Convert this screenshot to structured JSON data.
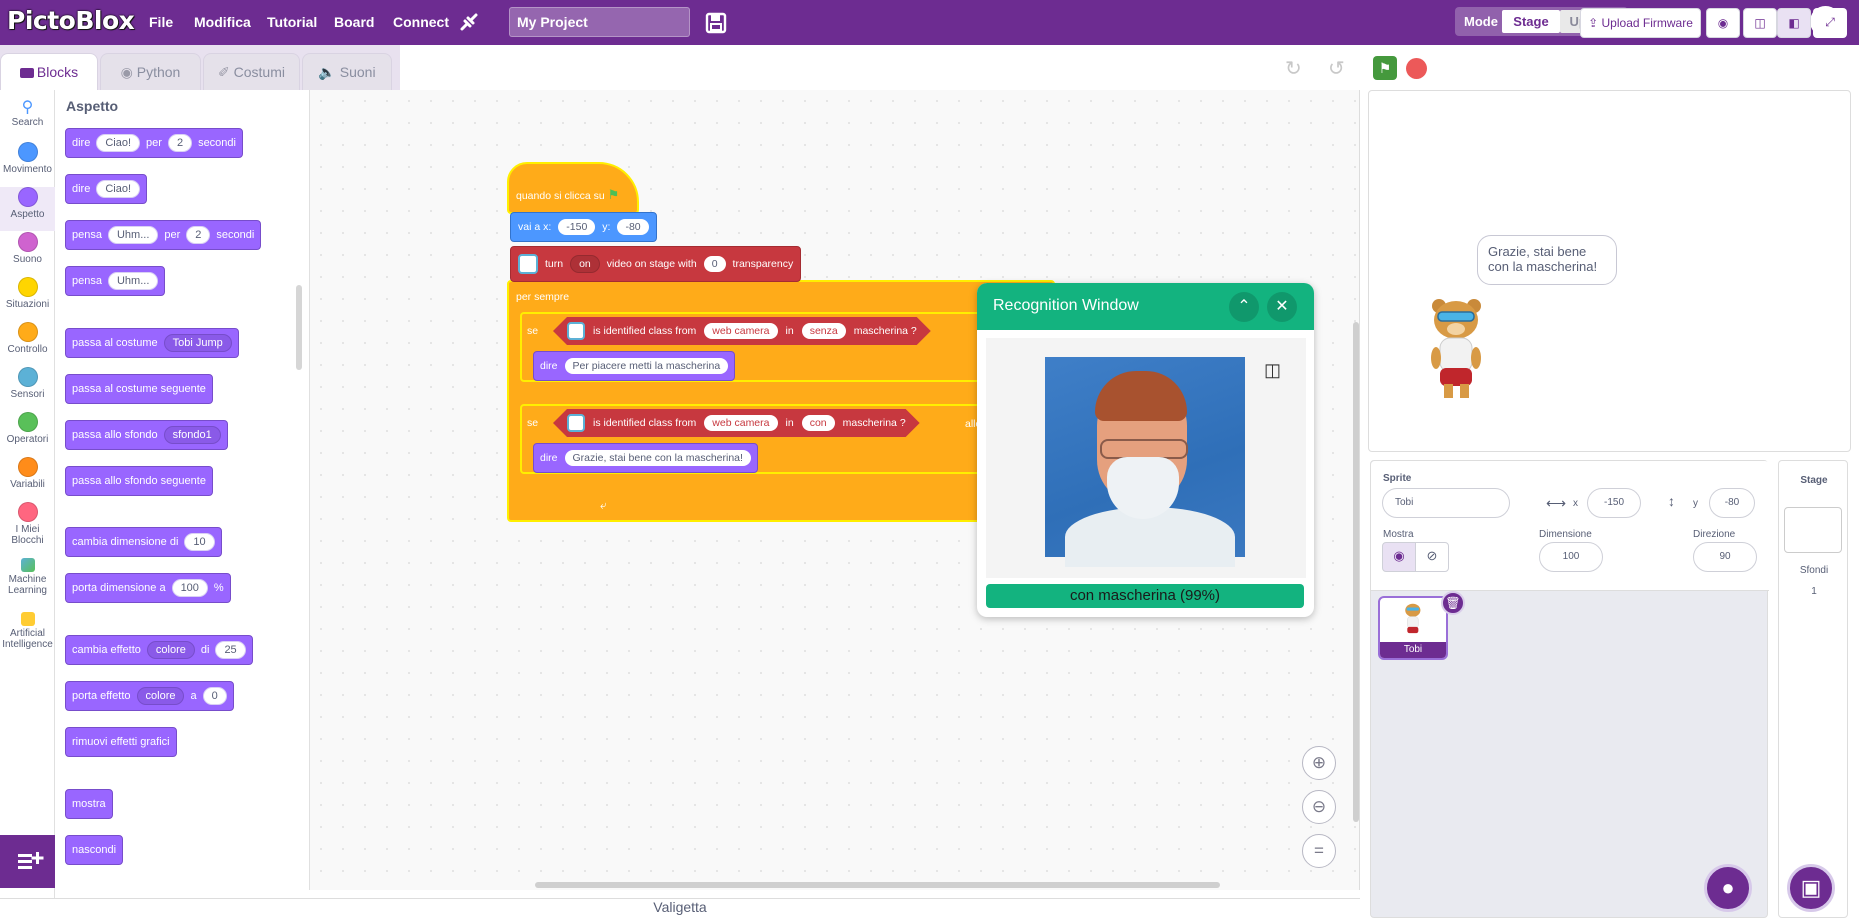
{
  "menubar": {
    "logo": "PictoBlox",
    "items": [
      "File",
      "Modifica",
      "Tutorial",
      "Board",
      "Connect"
    ],
    "project_title": "My Project",
    "mode_label": "Mode",
    "mode_stage": "Stage",
    "mode_upload": "Upload"
  },
  "tabs": [
    "Blocks",
    "Python",
    "Costumi",
    "Suoni"
  ],
  "categories": [
    {
      "label": "Search",
      "icon": "search-icon"
    },
    {
      "label": "Movimento",
      "color": "#4c97ff"
    },
    {
      "label": "Aspetto",
      "color": "#9966ff"
    },
    {
      "label": "Suono",
      "color": "#cf63cf"
    },
    {
      "label": "Situazioni",
      "color": "#ffd500"
    },
    {
      "label": "Controllo",
      "color": "#ffab19"
    },
    {
      "label": "Sensori",
      "color": "#5cb1d6"
    },
    {
      "label": "Operatori",
      "color": "#59c059"
    },
    {
      "label": "Variabili",
      "color": "#ff8c1a"
    },
    {
      "label": "I Miei Blocchi",
      "color": "#ff6680"
    },
    {
      "label": "Machine Learning",
      "icon": "ml-icon"
    },
    {
      "label": "Artificial Intelligence",
      "icon": "ai-icon"
    }
  ],
  "palette": {
    "title": "Aspetto",
    "b1": {
      "t1": "dire",
      "v1": "Ciao!",
      "t2": "per",
      "v2": "2",
      "t3": "secondi"
    },
    "b2": {
      "t1": "dire",
      "v1": "Ciao!"
    },
    "b3": {
      "t1": "pensa",
      "v1": "Uhm...",
      "t2": "per",
      "v2": "2",
      "t3": "secondi"
    },
    "b4": {
      "t1": "pensa",
      "v1": "Uhm..."
    },
    "b5": {
      "t1": "passa al costume",
      "v1": "Tobi Jump"
    },
    "b6": {
      "t1": "passa al costume seguente"
    },
    "b7": {
      "t1": "passa allo sfondo",
      "v1": "sfondo1"
    },
    "b8": {
      "t1": "passa allo sfondo seguente"
    },
    "b9": {
      "t1": "cambia dimensione di",
      "v1": "10"
    },
    "b10": {
      "t1": "porta dimensione a",
      "v1": "100",
      "t2": "%"
    },
    "b11": {
      "t1": "cambia effetto",
      "v1": "colore",
      "t2": "di",
      "v2": "25"
    },
    "b12": {
      "t1": "porta effetto",
      "v1": "colore",
      "t2": "a",
      "v2": "0"
    },
    "b13": {
      "t1": "rimuovi effetti grafici"
    },
    "b14": {
      "t1": "mostra"
    },
    "b15": {
      "t1": "nascondi"
    }
  },
  "script": {
    "hat": "quando si clicca su",
    "goto": {
      "t1": "vai a x:",
      "x": "-150",
      "t2": "y:",
      "y": "-80"
    },
    "video": {
      "t1": "turn",
      "v1": "on",
      "t2": "video on stage with",
      "v2": "0",
      "t3": "transparency"
    },
    "forever": "per sempre",
    "if1": {
      "se": "se",
      "t1": "is identified class from",
      "src": "web camera",
      "t2": "in",
      "cls": "senza",
      "t3": "mascherina ?"
    },
    "say1": {
      "t1": "dire",
      "v1": "Per piacere metti la mascherina"
    },
    "if2": {
      "se": "se",
      "t1": "is identified class from",
      "src": "web camera",
      "t2": "in",
      "cls": "con",
      "t3": "mascherina ?",
      "t4": "allo"
    },
    "say2": {
      "t1": "dire",
      "v1": "Grazie, stai bene con la mascherina!"
    }
  },
  "recognition": {
    "title": "Recognition Window",
    "result": "con mascherina (99%)"
  },
  "stagebar": {
    "upload_firmware": "Upload Firmware"
  },
  "stage": {
    "bubble": "Grazie, stai bene con la mascherina!"
  },
  "sprite": {
    "label": "Sprite",
    "name": "Tobi",
    "x_label": "x",
    "x": "-150",
    "y_label": "y",
    "y": "-80",
    "show_label": "Mostra",
    "size_label": "Dimensione",
    "size": "100",
    "dir_label": "Direzione",
    "direction": "90",
    "thumb_name": "Tobi"
  },
  "stagepane": {
    "title": "Stage",
    "backdrops_label": "Sfondi",
    "backdrops_count": "1"
  },
  "backpack": "Valigetta",
  "colors": {
    "brand": "#6d2c91",
    "looks": "#9966ff",
    "control": "#ffab19",
    "ai": "#c7383f",
    "ml_green": "#13b37f"
  }
}
